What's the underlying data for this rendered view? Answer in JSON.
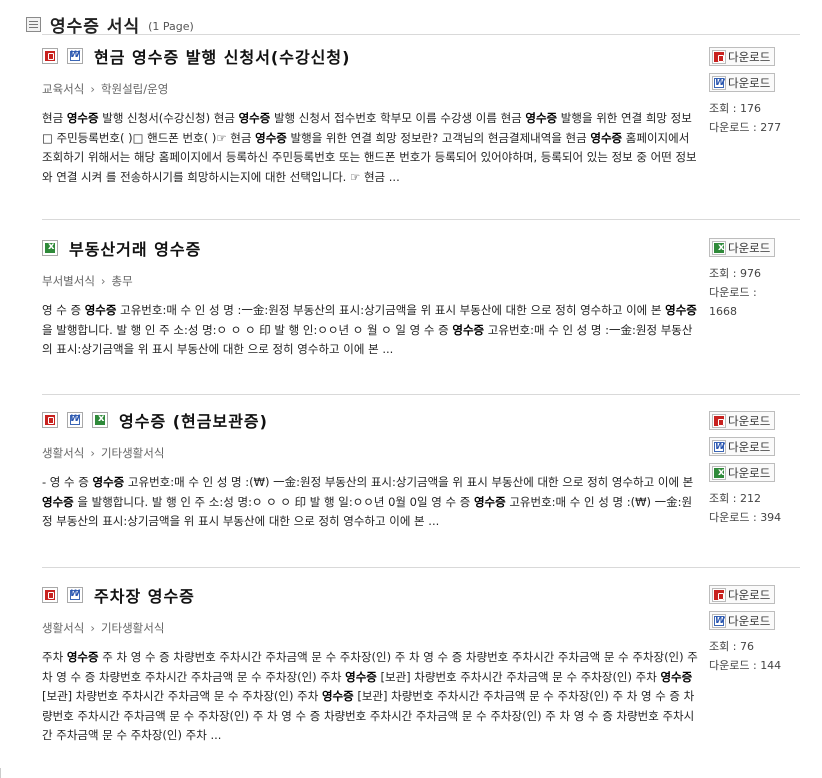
{
  "header": {
    "title": "영수증 서식",
    "count": "(1 Page)"
  },
  "download_label": "다운로드",
  "view_label": "조회",
  "download_count_label": "다운로드",
  "entries": [
    {
      "title": "현금 영수증 발행 신청서(수강신청)",
      "category": "교육서식",
      "subcategory": "학원설립/운영",
      "snippet": "현금 **영수증** 발행 신청서(수강신청) 현금 **영수증** 발행 신청서 접수번호 학부모 이름 수강생 이름 현금 **영수증** 발행을 위한 연결 희망 정보 □ 주민등록번호( )□ 핸드폰 번호( )☞ 현금 **영수증** 발행을 위한 연결 희망 정보란? 고객님의 현금결제내역을 현금 **영수증** 홈페이지에서 조회하기 위해서는 해당 홈페이지에서 등록하신 주민등록번호 또는 핸드폰 번호가 등록되어 있어야하며, 등록되어 있는 정보 중 어떤 정보와 연결 시켜 를 전송하시기를 희망하시는지에 대한 선택입니다. ☞ 현금 ...",
      "views": "176",
      "downloads": "277",
      "file_types": [
        "hwp",
        "doc"
      ]
    },
    {
      "title": "부동산거래 영수증",
      "category": "부서별서식",
      "subcategory": "총무",
      "snippet": "영 수 증 **영수증** 고유번호:매 수 인 성 명 :一金:원정 부동산의 표시:상기금액을 위 표시 부동산에 대한 으로 정히 영수하고 이에 본 **영수증** 을 발행합니다. 발 행 인 주 소:성 명:ㅇ ㅇ ㅇ 印 발 행 인:ㅇㅇ년 ㅇ 월 ㅇ 일 영 수 증 **영수증** 고유번호:매 수 인 성 명 :一金:원정 부동산의 표시:상기금액을 위 표시 부동산에 대한 으로 정히 영수하고 이에 본 ...",
      "views": "976",
      "downloads": "1668",
      "file_types": [
        "xls"
      ]
    },
    {
      "title": "영수증 (현금보관증)",
      "category": "생활서식",
      "subcategory": "기타생활서식",
      "snippet": "- 영 수 증 **영수증** 고유번호:매 수 인 성 명 :(₩) 一金:원정 부동산의 표시:상기금액을 위 표시 부동산에 대한 으로 정히 영수하고 이에 본 **영수증** 을 발행합니다. 발 행 인 주 소:성 명:ㅇ ㅇ ㅇ 印 발 행 일:ㅇㅇ년 0월 0일 영 수 증 **영수증** 고유번호:매 수 인 성 명 :(₩) 一金:원정 부동산의 표시:상기금액을 위 표시 부동산에 대한 으로 정히 영수하고 이에 본 ...",
      "views": "212",
      "downloads": "394",
      "file_types": [
        "hwp",
        "doc",
        "xls"
      ]
    },
    {
      "title": "주차장 영수증",
      "category": "생활서식",
      "subcategory": "기타생활서식",
      "snippet": "주차 **영수증** 주 차 영 수 증 차량번호 주차시간 주차금액 문 수 주차장(인) 주 차 영 수 증 차량번호 주차시간 주차금액 문 수 주차장(인) 주 차 영 수 증 차량번호 주차시간 주차금액 문 수 주차장(인) 주차 **영수증** [보관] 차량번호 주차시간 주차금액 문 수 주차장(인) 주차 **영수증** [보관] 차량번호 주차시간 주차금액 문 수 주차장(인) 주차 **영수증** [보관] 차량번호 주차시간 주차금액 문 수 주차장(인) 주 차 영 수 증 차량번호 주차시간 주차금액 문 수 주차장(인) 주 차 영 수 증 차량번호 주차시간 주차금액 문 수 주차장(인) 주 차 영 수 증 차량번호 주차시간 주차금액 문 수 주차장(인) 주차 ...",
      "views": "76",
      "downloads": "144",
      "file_types": [
        "hwp",
        "doc"
      ]
    }
  ]
}
